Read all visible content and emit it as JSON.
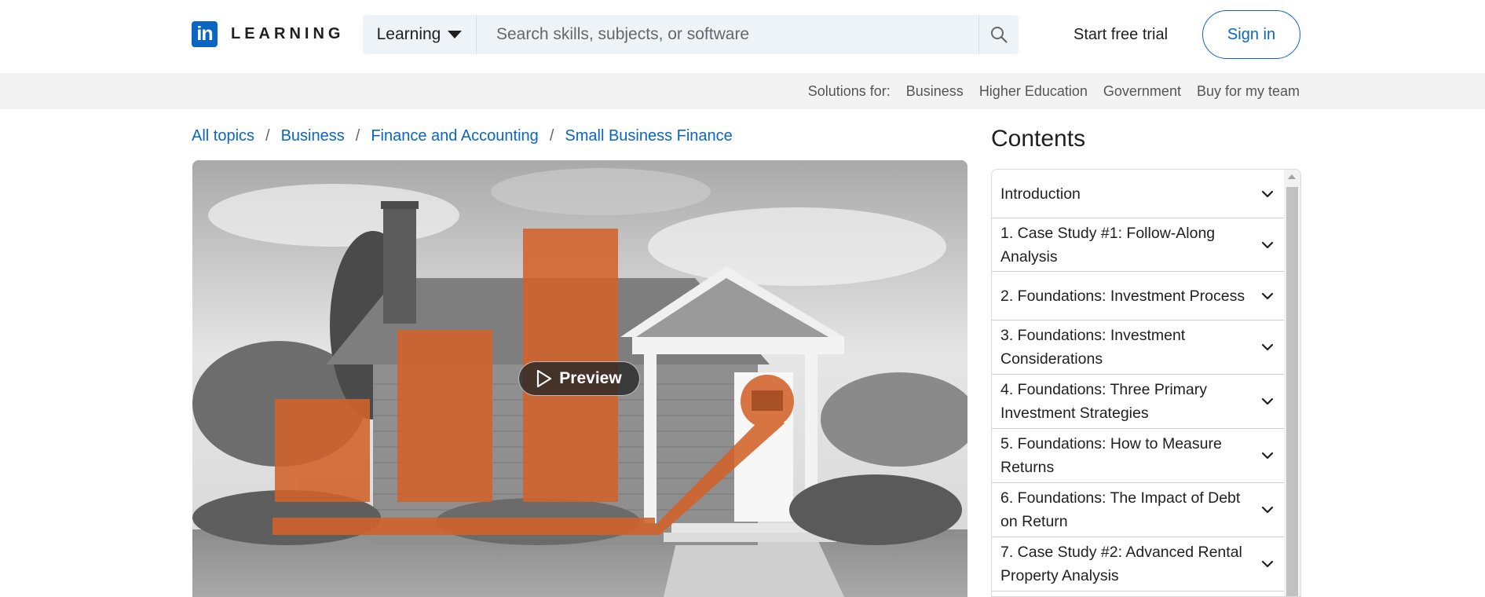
{
  "header": {
    "logo_mark": "in",
    "logo_text": "LEARNING",
    "search": {
      "scope_label": "Learning",
      "placeholder": "Search skills, subjects, or software",
      "value": "",
      "icon": "search-icon"
    },
    "start_trial_label": "Start free trial",
    "sign_in_label": "Sign in"
  },
  "solutions_bar": {
    "label": "Solutions for:",
    "links": [
      "Business",
      "Higher Education",
      "Government",
      "Buy for my team"
    ]
  },
  "breadcrumb": {
    "items": [
      "All topics",
      "Business",
      "Finance and Accounting",
      "Small Business Finance"
    ],
    "separator": "/"
  },
  "hero": {
    "preview_label": "Preview",
    "play_icon": "play-icon"
  },
  "contents": {
    "title": "Contents",
    "items": [
      {
        "label": "Introduction"
      },
      {
        "label": "1. Case Study #1: Follow-Along Analysis"
      },
      {
        "label": "2. Foundations: Investment Process"
      },
      {
        "label": "3. Foundations: Investment Considerations"
      },
      {
        "label": "4. Foundations: Three Primary Investment Strategies"
      },
      {
        "label": "5. Foundations: How to Measure Returns"
      },
      {
        "label": "6. Foundations: The Impact of Debt on Return"
      },
      {
        "label": "7. Case Study #2: Advanced Rental Property Analysis"
      }
    ],
    "expand_icon": "chevron-down-icon"
  },
  "colors": {
    "brand_blue": "#0a66c2",
    "accent_orange": "#d2622a",
    "search_bg": "#eef3f8",
    "solutions_bg": "#f3f3f3"
  }
}
